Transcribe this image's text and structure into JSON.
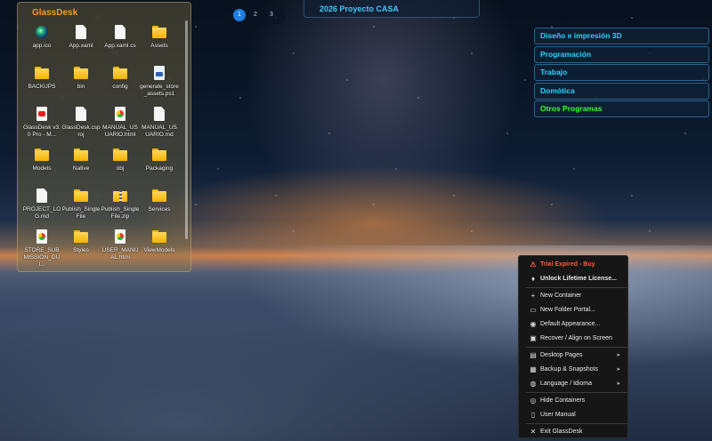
{
  "desktop": {
    "container": {
      "title": "GlassDesk",
      "files": [
        {
          "label": "app.ico",
          "icon": "app-icon"
        },
        {
          "label": "App.xaml",
          "icon": "document-icon"
        },
        {
          "label": "App.xaml.cs",
          "icon": "document-icon"
        },
        {
          "label": "Assets",
          "icon": "folder-icon"
        },
        {
          "label": "BACKUPS",
          "icon": "folder-icon"
        },
        {
          "label": "bin",
          "icon": "folder-icon"
        },
        {
          "label": "config",
          "icon": "folder-icon"
        },
        {
          "label": "generate_store_assets.ps1",
          "icon": "powershell-script-icon"
        },
        {
          "label": "GlassDesk v3.0 Pro - M...",
          "icon": "pdf-icon"
        },
        {
          "label": "GlassDesk.csproj",
          "icon": "document-icon"
        },
        {
          "label": "MANUAL_USUARIO.html",
          "icon": "chrome-html-icon"
        },
        {
          "label": "MANUAL_USUARIO.md",
          "icon": "document-icon"
        },
        {
          "label": "Models",
          "icon": "folder-icon"
        },
        {
          "label": "Native",
          "icon": "folder-icon"
        },
        {
          "label": "obj",
          "icon": "folder-icon"
        },
        {
          "label": "Packaging",
          "icon": "folder-icon"
        },
        {
          "label": "PROJECT_LOG.md",
          "icon": "document-icon"
        },
        {
          "label": "Publish_SingleFile",
          "icon": "folder-icon"
        },
        {
          "label": "Publish_SingleFile.zip",
          "icon": "zip-folder-icon"
        },
        {
          "label": "Services",
          "icon": "folder-icon"
        },
        {
          "label": "STORE_SUBMISSION_GUI...",
          "icon": "chrome-html-icon"
        },
        {
          "label": "Styles",
          "icon": "folder-icon"
        },
        {
          "label": "USER_MANUAL.html",
          "icon": "chrome-html-icon"
        },
        {
          "label": "ViewModels",
          "icon": "folder-icon"
        }
      ]
    },
    "pager": {
      "pages": [
        "1",
        "2",
        "3"
      ],
      "active": "1"
    },
    "top_container": {
      "title": "2026 Proyecto CASA"
    },
    "categories": [
      {
        "label": "Diseño e impresión 3D",
        "color": "#2fd3ff"
      },
      {
        "label": "Programación",
        "color": "#2fd3ff"
      },
      {
        "label": "Trabajo",
        "color": "#2fd3ff"
      },
      {
        "label": "Domótica",
        "color": "#2fd3ff"
      },
      {
        "label": "Otros Programas",
        "color": "#3cff3c"
      }
    ]
  },
  "context_menu": {
    "trial": "Trial Expired - Buy",
    "unlock": "Unlock Lifetime License...",
    "new_container": "New Container",
    "new_portal": "New Folder Portal...",
    "default_appearance": "Default Appearance...",
    "recover": "Recover / Align on Screen",
    "desktop_pages": "Desktop Pages",
    "backup": "Backup & Snapshots",
    "language": "Language / Idioma",
    "hide": "Hide Containers",
    "manual": "User Manual",
    "exit": "Exit GlassDesk"
  },
  "colors": {
    "accent_orange": "#ff9a1a",
    "accent_cyan": "#2fd3ff",
    "warning_red": "#ff5b3a"
  }
}
